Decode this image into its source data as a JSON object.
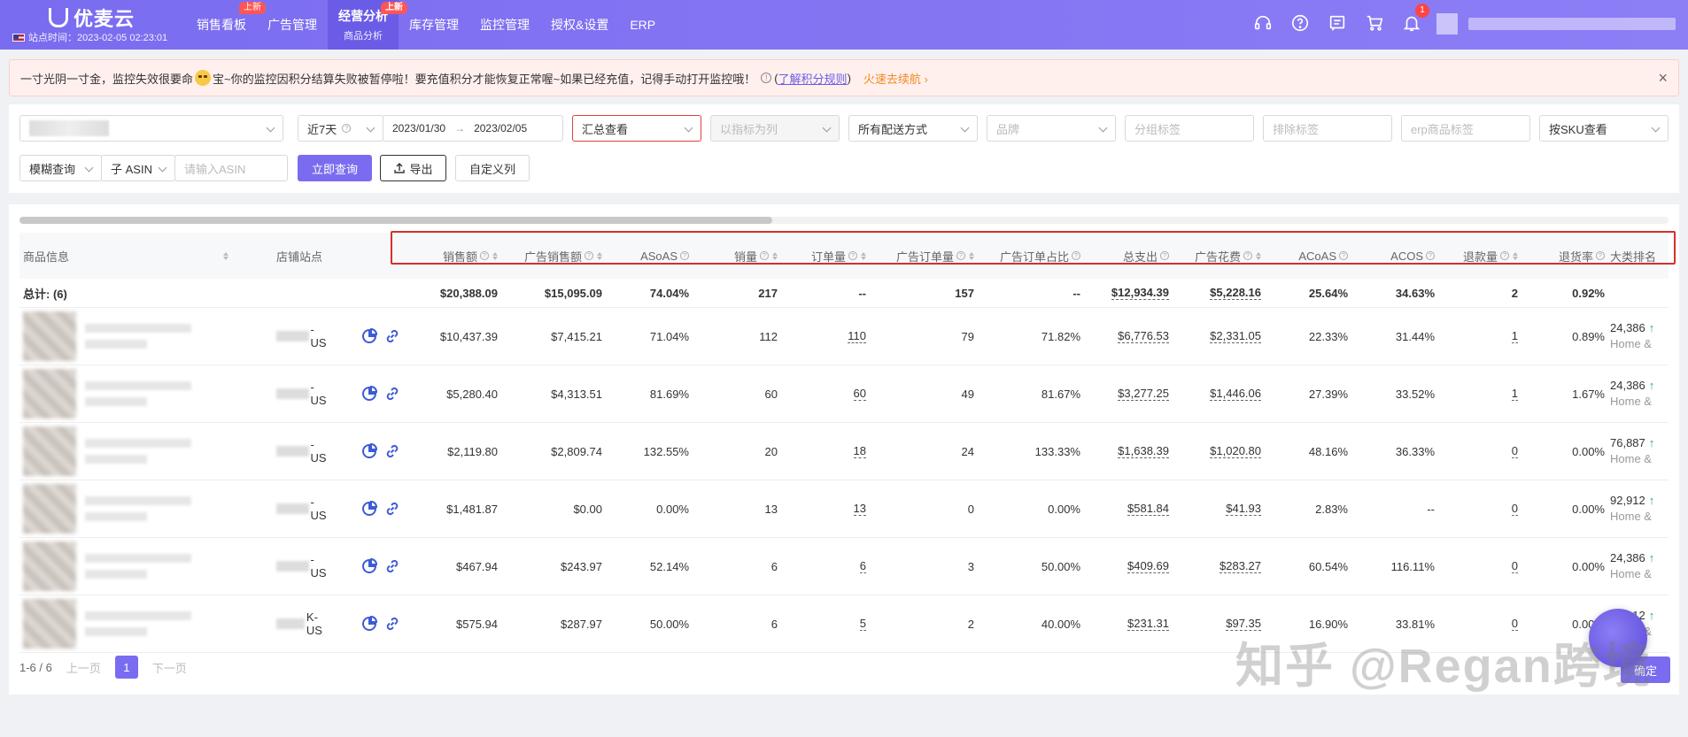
{
  "header": {
    "brand": "优麦云",
    "site_time": "站点时间：2023-02-05 02:23:01",
    "nav": [
      {
        "label": "销售看板",
        "badge": "上新"
      },
      {
        "label": "广告管理",
        "badge": ""
      },
      {
        "label": "经营分析",
        "sub": "商品分析",
        "badge": "上新",
        "active": true
      },
      {
        "label": "库存管理",
        "badge": ""
      },
      {
        "label": "监控管理",
        "badge": ""
      },
      {
        "label": "授权&设置",
        "badge": ""
      },
      {
        "label": "ERP",
        "badge": ""
      }
    ],
    "icons": [
      "headset-icon",
      "help-icon",
      "message-icon",
      "cart-icon",
      "bell-icon"
    ],
    "notification_count": "1"
  },
  "alert": {
    "text_before": "一寸光阴一寸金，监控失效很要命",
    "text_after": "宝~你的监控因积分结算失败被暂停啦！要充值积分才能恢复正常喔~如果已经充值，记得手动打开监控哦！",
    "link": "了解积分规则",
    "recharge": "火速去续航 ›",
    "close": "×"
  },
  "filters": {
    "period": "近7天",
    "date_start": "2023/01/30",
    "date_end": "2023/02/05",
    "date_arrow": "→",
    "view_mode": "汇总查看",
    "indicator_column": "以指标为列",
    "delivery": "所有配送方式",
    "brand_placeholder": "品牌",
    "group_tag_placeholder": "分组标签",
    "exclude_tag_placeholder": "排除标签",
    "erp_tag_placeholder": "erp商品标签",
    "sku_view": "按SKU查看",
    "fuzzy": "模糊查询",
    "asin_type": "子 ASIN",
    "asin_placeholder": "请输入ASIN",
    "query_btn": "立即查询",
    "export_btn": "导出",
    "custom_cols_btn": "自定义列"
  },
  "table": {
    "headers": {
      "product": "商品信息",
      "shop": "店铺站点",
      "sales": "销售额",
      "ad_sales": "广告销售额",
      "asoas": "ASoAS",
      "units": "销量",
      "orders": "订单量",
      "ad_orders": "广告订单量",
      "ad_order_ratio": "广告订单占比",
      "total_spend": "总支出",
      "ad_spend": "广告花费",
      "acoas": "ACoAS",
      "acos": "ACOS",
      "refunds": "退款量",
      "refund_rate": "退货率",
      "rank": "大类排名"
    },
    "total": {
      "label": "总计: (6)",
      "sales": "$20,388.09",
      "ad_sales": "$15,095.09",
      "asoas": "74.04%",
      "units": "217",
      "orders": "--",
      "ad_orders": "157",
      "ad_order_ratio": "--",
      "total_spend": "$12,934.39",
      "ad_spend": "$5,228.16",
      "acoas": "25.64%",
      "acos": "34.63%",
      "refunds": "2",
      "refund_rate": "0.92%"
    },
    "rows": [
      {
        "shop": "-US",
        "sales": "$10,437.39",
        "ad_sales": "$7,415.21",
        "asoas": "71.04%",
        "units": "112",
        "orders": "110",
        "ad_orders": "79",
        "ad_order_ratio": "71.82%",
        "total_spend": "$6,776.53",
        "ad_spend": "$2,331.05",
        "acoas": "22.33%",
        "acos": "31.44%",
        "refunds": "1",
        "refund_rate": "0.89%",
        "rank": "24,386",
        "category": "Home &"
      },
      {
        "shop": "-US",
        "sales": "$5,280.40",
        "ad_sales": "$4,313.51",
        "asoas": "81.69%",
        "units": "60",
        "orders": "60",
        "ad_orders": "49",
        "ad_order_ratio": "81.67%",
        "total_spend": "$3,277.25",
        "ad_spend": "$1,446.06",
        "acoas": "27.39%",
        "acos": "33.52%",
        "refunds": "1",
        "refund_rate": "1.67%",
        "rank": "24,386",
        "category": "Home &"
      },
      {
        "shop": "-US",
        "sales": "$2,119.80",
        "ad_sales": "$2,809.74",
        "asoas": "132.55%",
        "units": "20",
        "orders": "18",
        "ad_orders": "24",
        "ad_order_ratio": "133.33%",
        "total_spend": "$1,638.39",
        "ad_spend": "$1,020.80",
        "acoas": "48.16%",
        "acos": "36.33%",
        "refunds": "0",
        "refund_rate": "0.00%",
        "rank": "76,887",
        "category": "Home &"
      },
      {
        "shop": "-US",
        "sales": "$1,481.87",
        "ad_sales": "$0.00",
        "asoas": "0.00%",
        "units": "13",
        "orders": "13",
        "ad_orders": "0",
        "ad_order_ratio": "0.00%",
        "total_spend": "$581.84",
        "ad_spend": "$41.93",
        "acoas": "2.83%",
        "acos": "--",
        "refunds": "0",
        "refund_rate": "0.00%",
        "rank": "92,912",
        "category": "Home &"
      },
      {
        "shop": "-US",
        "sales": "$467.94",
        "ad_sales": "$243.97",
        "asoas": "52.14%",
        "units": "6",
        "orders": "6",
        "ad_orders": "3",
        "ad_order_ratio": "50.00%",
        "total_spend": "$409.69",
        "ad_spend": "$283.27",
        "acoas": "60.54%",
        "acos": "116.11%",
        "refunds": "0",
        "refund_rate": "0.00%",
        "rank": "24,386",
        "category": "Home &"
      },
      {
        "shop": "K-US",
        "sales": "$575.94",
        "ad_sales": "$287.97",
        "asoas": "50.00%",
        "units": "6",
        "orders": "5",
        "ad_orders": "2",
        "ad_order_ratio": "40.00%",
        "total_spend": "$231.31",
        "ad_spend": "$97.35",
        "acoas": "16.90%",
        "acos": "33.81%",
        "refunds": "0",
        "refund_rate": "0.00%",
        "rank": "92,912",
        "category": "Home &"
      }
    ]
  },
  "pager": {
    "range": "1-6 / 6",
    "prev": "上一页",
    "page": "1",
    "next": "下一页",
    "confirm": "确定"
  },
  "watermark": "知乎 @Regan跨境",
  "colors": {
    "primary": "#7a6cf0",
    "highlight_border": "#d6302b",
    "rank_up": "#1bb36a"
  }
}
